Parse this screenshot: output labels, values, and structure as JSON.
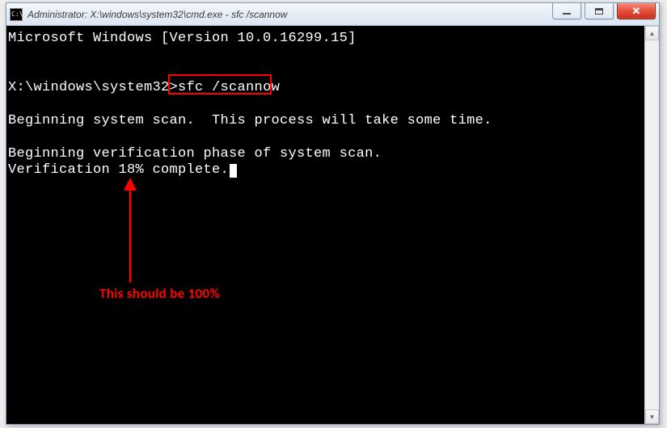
{
  "titlebar": {
    "icon_text": "C:\\.",
    "title": "Administrator: X:\\windows\\system32\\cmd.exe - sfc  /scannow"
  },
  "window_controls": {
    "minimize_aria": "Minimize",
    "maximize_aria": "Maximize",
    "close_aria": "Close"
  },
  "console": {
    "line1": "Microsoft Windows [Version 10.0.16299.15]",
    "blank1": "",
    "blank2": "",
    "prompt_prefix": "X:\\windows\\system32>",
    "command": "sfc /scannow",
    "blank3": "",
    "line_scan": "Beginning system scan.  This process will take some time.",
    "blank4": "",
    "line_verify_phase": "Beginning verification phase of system scan.",
    "line_progress_prefix": "Verification ",
    "progress_percent": "18%",
    "line_progress_suffix": " complete."
  },
  "annotation": {
    "text": "This should be 100%"
  },
  "scrollbar": {
    "up_glyph": "▴",
    "down_glyph": "▾"
  },
  "colors": {
    "highlight": "#ff0000",
    "console_bg": "#000000",
    "console_fg": "#ffffff"
  }
}
